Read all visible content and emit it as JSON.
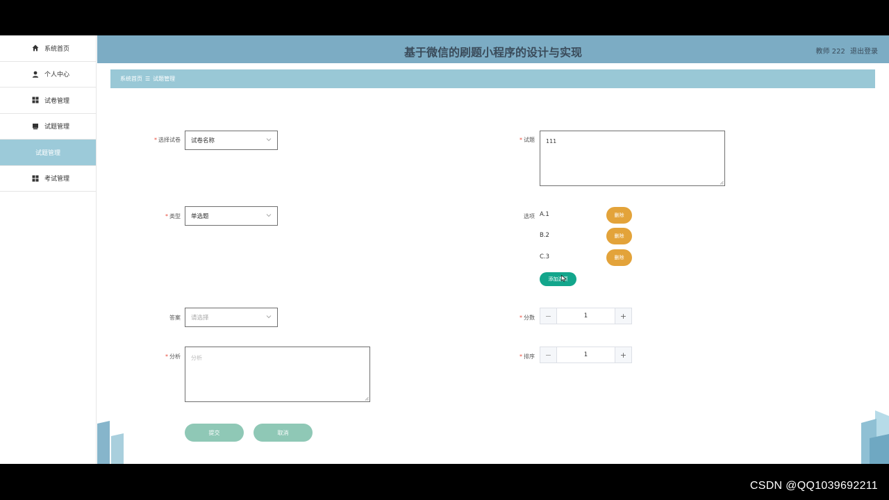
{
  "sidebar": {
    "items": [
      {
        "label": "系统首页",
        "icon": "home-icon"
      },
      {
        "label": "个人中心",
        "icon": "user-icon"
      },
      {
        "label": "试卷管理",
        "icon": "grid-icon"
      },
      {
        "label": "试题管理",
        "icon": "book-icon"
      },
      {
        "label": "试题管理",
        "icon": ""
      },
      {
        "label": "考试管理",
        "icon": "grid-icon"
      }
    ]
  },
  "header": {
    "title": "基于微信的刷题小程序的设计与实现",
    "user": "教师 222",
    "logout": "退出登录"
  },
  "breadcrumb": {
    "home": "系统首页",
    "sep": "☰",
    "current": "试题管理"
  },
  "form": {
    "paper": {
      "label": "选择试卷",
      "value": "试卷名称"
    },
    "type": {
      "label": "类型",
      "value": "单选题"
    },
    "answer": {
      "label": "答案",
      "placeholder": "请选择"
    },
    "analysis": {
      "label": "分析",
      "placeholder": "分析"
    },
    "question": {
      "label": "试题",
      "value": "111"
    },
    "options": {
      "label": "选项",
      "items": [
        {
          "text": "A.1",
          "delete": "删除"
        },
        {
          "text": "B.2",
          "delete": "删除"
        },
        {
          "text": "C.3",
          "delete": "删除"
        }
      ],
      "add": "添加选项"
    },
    "score": {
      "label": "分数",
      "value": "1",
      "minus": "−",
      "plus": "+"
    },
    "order": {
      "label": "排序",
      "value": "1",
      "minus": "−",
      "plus": "+"
    },
    "submit": "提交",
    "cancel": "取消"
  },
  "watermark": "CSDN @QQ1039692211",
  "colors": {
    "header": "#7cacc4",
    "breadcrumb": "#99c8d6",
    "active_nav": "#9ccad9",
    "delete_button": "#e3a33a",
    "add_button": "#13a68c",
    "action_button": "#8fc8b6"
  }
}
